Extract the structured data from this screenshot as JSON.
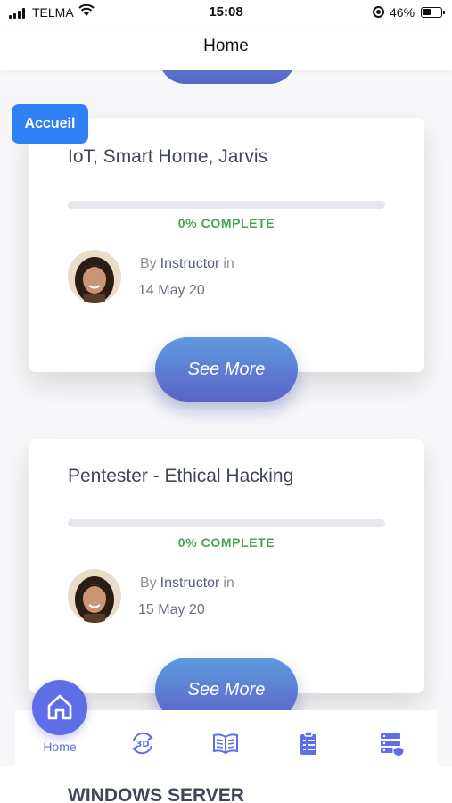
{
  "status": {
    "carrier": "TELMA",
    "time": "15:08",
    "battery": "46%",
    "battery_level": 0.46
  },
  "header": {
    "title": "Home"
  },
  "badge": "Accueil",
  "courses": [
    {
      "title": "IoT, Smart Home, Jarvis",
      "progress": 0,
      "complete_label": "0% COMPLETE",
      "by": "By",
      "instructor": "Instructor",
      "in": "in",
      "date": "14 May 20",
      "button": "See More"
    },
    {
      "title": "Pentester - Ethical Hacking",
      "progress": 0,
      "complete_label": "0% COMPLETE",
      "by": "By",
      "instructor": "Instructor",
      "in": "in",
      "date": "15 May 20",
      "button": "See More"
    }
  ],
  "tabs": [
    {
      "label": "Home",
      "icon": "home-icon"
    },
    {
      "icon": "3d-rotate-icon"
    },
    {
      "icon": "open-book-icon"
    },
    {
      "icon": "clipboard-list-icon"
    },
    {
      "icon": "server-icon"
    }
  ],
  "next_section": "WINDOWS SERVER",
  "colors": {
    "accent": "#5d6ee6",
    "badge": "#2f7ff5",
    "complete": "#44a653"
  }
}
